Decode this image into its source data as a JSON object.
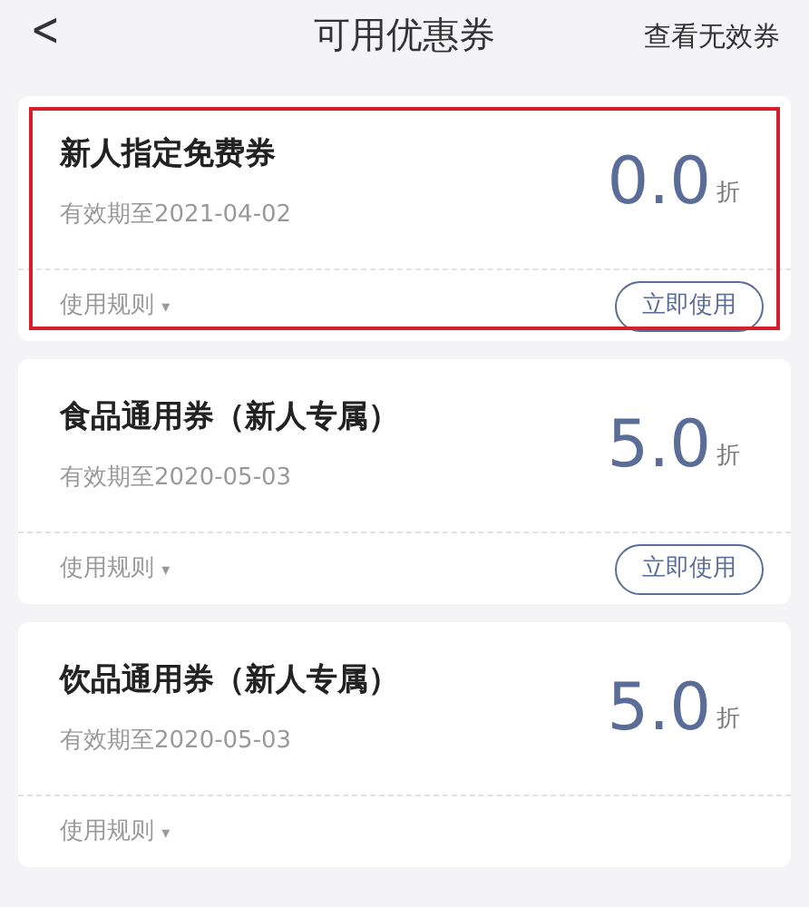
{
  "header": {
    "back": "<",
    "title": "可用优惠券",
    "action": "查看无效券"
  },
  "coupons": [
    {
      "name": "新人指定免费券",
      "validity": "有效期至2021-04-02",
      "discount": "0.0",
      "unit": "折",
      "rules": "使用规则",
      "rules_caret": "▾",
      "button": "立即使用",
      "highlighted": true
    },
    {
      "name": "食品通用券（新人专属）",
      "validity": "有效期至2020-05-03",
      "discount": "5.0",
      "unit": "折",
      "rules": "使用规则",
      "rules_caret": "▾",
      "button": "立即使用",
      "highlighted": false
    },
    {
      "name": "饮品通用券（新人专属）",
      "validity": "有效期至2020-05-03",
      "discount": "5.0",
      "unit": "折",
      "rules": "使用规则",
      "rules_caret": "▾",
      "highlighted": false
    }
  ]
}
